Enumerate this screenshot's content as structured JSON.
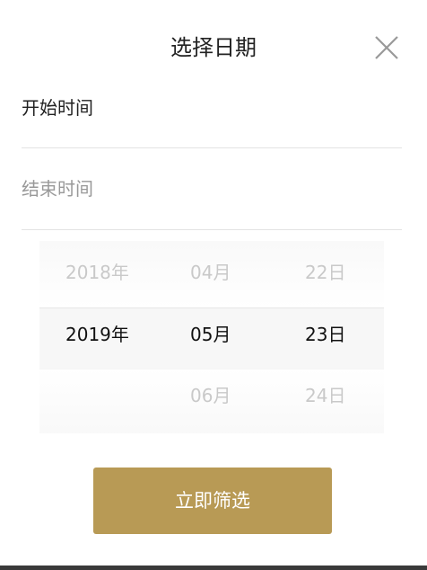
{
  "dialog": {
    "title": "选择日期",
    "start_label": "开始时间",
    "end_label": "结束时间",
    "confirm_label": "立即筛选"
  },
  "picker": {
    "years": [
      "2018年",
      "2019年",
      ""
    ],
    "months": [
      "04月",
      "05月",
      "06月"
    ],
    "days": [
      "22日",
      "23日",
      "24日"
    ]
  },
  "colors": {
    "accent": "#b89a55",
    "text": "#222222",
    "muted": "#999999",
    "inactive": "#c9c9c9"
  },
  "icons": {
    "close": "close-icon"
  }
}
